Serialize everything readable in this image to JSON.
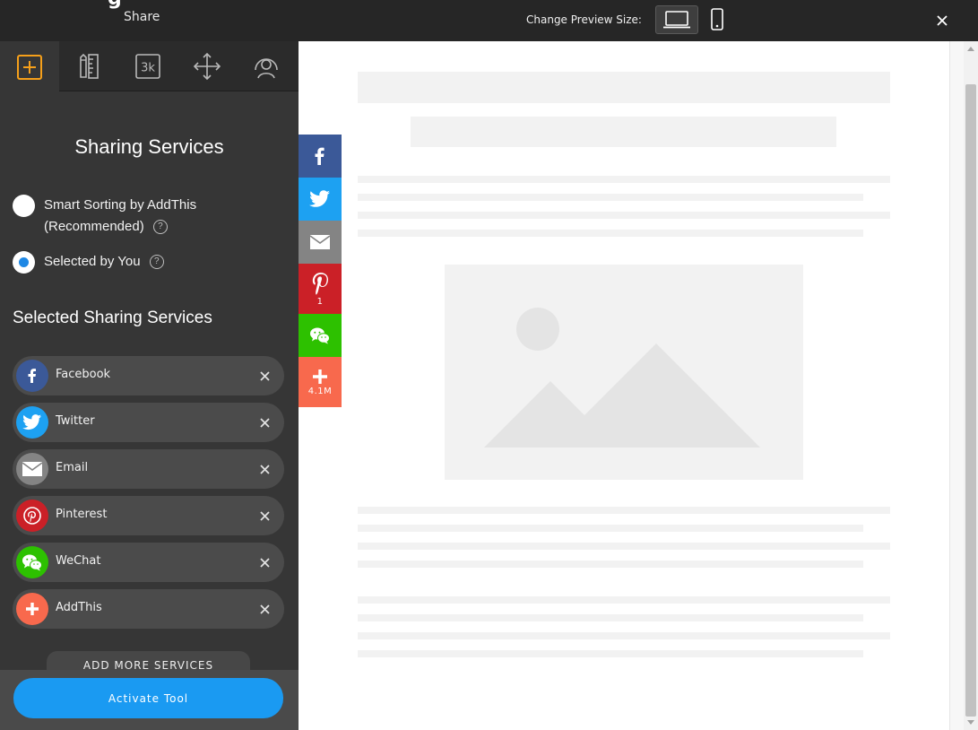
{
  "topbar": {
    "app_title_fragment": "g",
    "subtitle": "Share",
    "preview_size_label": "Change Preview Size:"
  },
  "tabs": [
    {
      "icon": "add-square-icon",
      "active": true
    },
    {
      "icon": "ruler-pencil-icon",
      "active": false
    },
    {
      "icon": "counter-3k-icon",
      "label": "3k",
      "active": false
    },
    {
      "icon": "move-arrows-icon",
      "active": false
    },
    {
      "icon": "person-target-icon",
      "active": false
    }
  ],
  "sharing": {
    "heading": "Sharing Services",
    "options": [
      {
        "label_line1": "Smart Sorting by AddThis",
        "label_line2": "(Recommended)",
        "selected": false
      },
      {
        "label_line1": "Selected by You",
        "selected": true
      }
    ],
    "help_symbol": "?",
    "selected_heading": "Selected Sharing Services",
    "services": [
      {
        "name": "Facebook",
        "color": "#3b5998",
        "icon": "facebook-icon"
      },
      {
        "name": "Twitter",
        "color": "#1da1f2",
        "icon": "twitter-icon"
      },
      {
        "name": "Email",
        "color": "#848484",
        "icon": "email-icon"
      },
      {
        "name": "Pinterest",
        "color": "#cb2027",
        "icon": "pinterest-icon"
      },
      {
        "name": "WeChat",
        "color": "#2dc100",
        "icon": "wechat-icon"
      },
      {
        "name": "AddThis",
        "color": "#f8694d",
        "icon": "plus-icon"
      }
    ],
    "add_more_label": "ADD MORE SERVICES",
    "activate_label": "Activate Tool"
  },
  "share_bar": [
    {
      "service": "Facebook",
      "color": "#3b5998",
      "icon": "facebook-icon",
      "count": ""
    },
    {
      "service": "Twitter",
      "color": "#1da1f2",
      "icon": "twitter-icon",
      "count": ""
    },
    {
      "service": "Email",
      "color": "#848484",
      "icon": "email-icon",
      "count": ""
    },
    {
      "service": "Pinterest",
      "color": "#cb2027",
      "icon": "pinterest-icon",
      "count": "1"
    },
    {
      "service": "WeChat",
      "color": "#2dc100",
      "icon": "wechat-icon",
      "count": ""
    },
    {
      "service": "AddThis",
      "color": "#f8694d",
      "icon": "plus-icon",
      "count": "4.1M"
    }
  ],
  "colors": {
    "accent_orange": "#f6a01a",
    "activate_blue": "#1a9af2",
    "radio_selected": "#1e88e5"
  }
}
